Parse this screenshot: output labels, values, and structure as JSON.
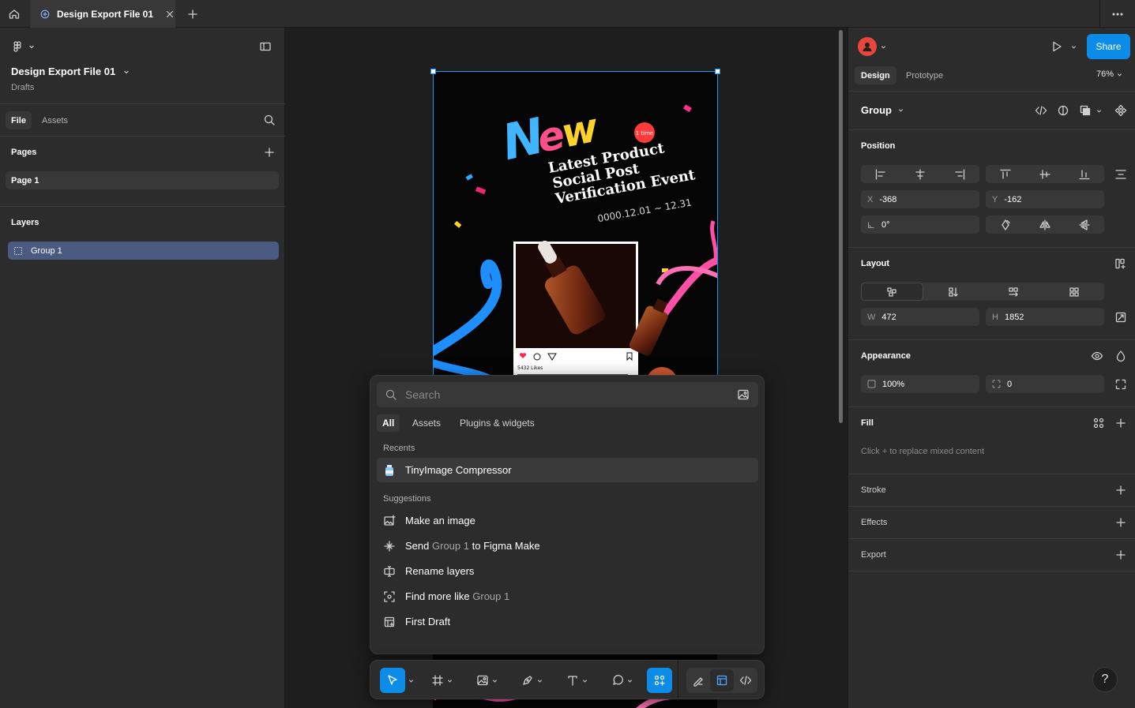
{
  "titlebar": {
    "tab_title": "Design Export File 01",
    "home_icon": "home-icon",
    "new_tab_icon": "plus-icon",
    "more_icon": "ellipsis-icon"
  },
  "left_panel": {
    "file_name": "Design Export File 01",
    "location": "Drafts",
    "tabs": [
      "File",
      "Assets"
    ],
    "pages_title": "Pages",
    "pages": [
      "Page 1"
    ],
    "layers_title": "Layers",
    "layers": [
      "Group 1"
    ]
  },
  "artboard": {
    "headline": "New",
    "badge": "1 time",
    "line1": "Latest Product",
    "line2": "Social Post",
    "line3": "Verification Event",
    "date": "0000.12.01 ~ 12.31",
    "likes": "5432 Likes"
  },
  "quick_actions": {
    "search_placeholder": "Search",
    "tabs": [
      "All",
      "Assets",
      "Plugins & widgets"
    ],
    "recents_title": "Recents",
    "recents": [
      "TinyImage Compressor"
    ],
    "suggestions_title": "Suggestions",
    "suggestions": {
      "make_image": "Make an image",
      "send_pre": "Send",
      "send_obj": "Group 1",
      "send_post": "to Figma Make",
      "rename": "Rename layers",
      "find_pre": "Find more like",
      "find_obj": "Group 1",
      "first_draft": "First Draft"
    }
  },
  "right_panel": {
    "share_label": "Share",
    "tabs": [
      "Design",
      "Prototype"
    ],
    "zoom": "76%",
    "selection_type": "Group",
    "position_title": "Position",
    "x_label": "X",
    "x_value": "-368",
    "y_label": "Y",
    "y_value": "-162",
    "rotation": "0°",
    "layout_title": "Layout",
    "w_label": "W",
    "w_value": "472",
    "h_label": "H",
    "h_value": "1852",
    "appearance_title": "Appearance",
    "opacity": "100%",
    "corner_radius": "0",
    "fill_title": "Fill",
    "fill_hint": "Click + to replace mixed content",
    "stroke_title": "Stroke",
    "effects_title": "Effects",
    "export_title": "Export",
    "help_label": "?"
  },
  "colors": {
    "accent": "#0d99ff",
    "share_button": "#0c8ce9",
    "panel_bg": "#2c2c2c",
    "canvas_bg": "#1e1e1e",
    "avatar": "#e8453c"
  }
}
